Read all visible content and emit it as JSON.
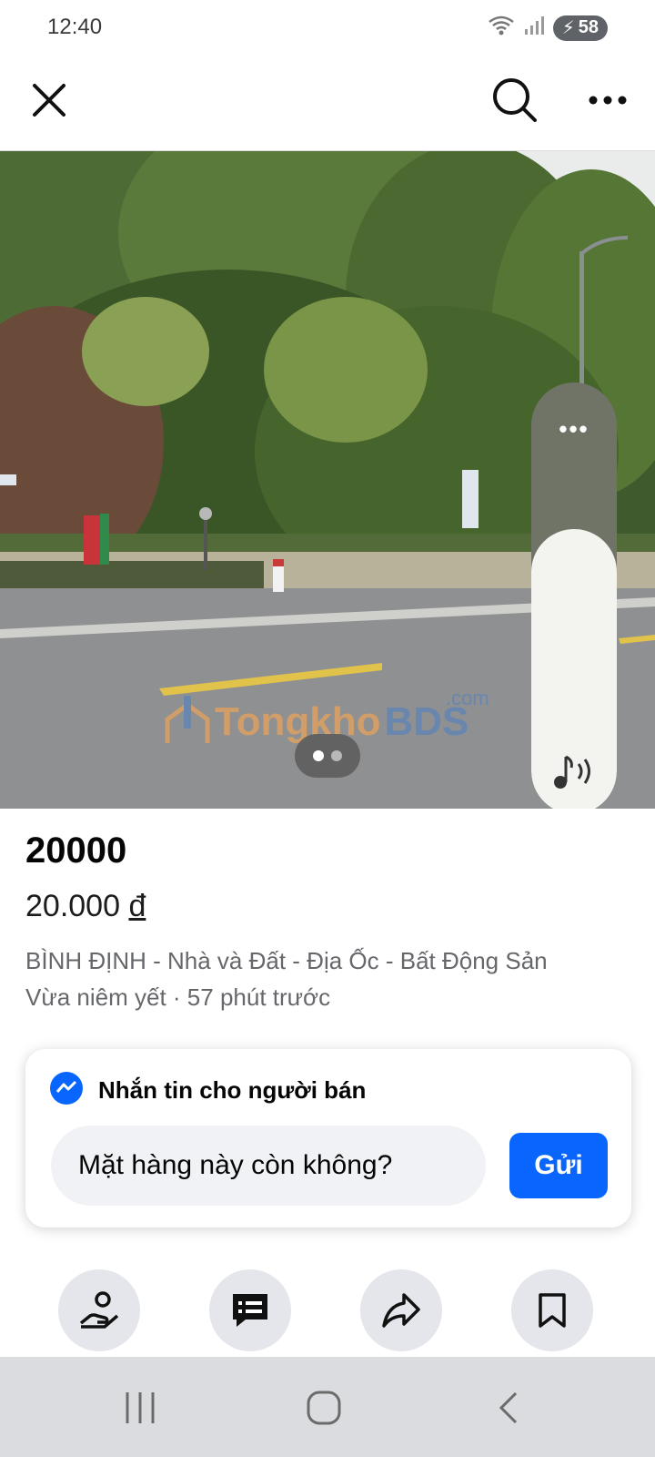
{
  "status_bar": {
    "time": "12:40",
    "battery": "58",
    "icons": [
      "wifi-icon",
      "signal-icon",
      "battery-charging-icon"
    ]
  },
  "top_bar": {
    "icons": [
      "close-icon",
      "search-icon",
      "more-icon"
    ]
  },
  "media": {
    "watermark": {
      "left": "Tongkho",
      "right": "BDS",
      "suffix": ".com"
    },
    "pager": {
      "total": 2,
      "current": 1
    },
    "volume_level": 0.66
  },
  "listing": {
    "title": "20000",
    "price_value": "20.000",
    "price_currency": "đ",
    "category": "BÌNH ĐỊNH - Nhà và Đất - Địa Ốc - Bất Động Sản",
    "posted": "Vừa niêm yết · 57 phút trước"
  },
  "message": {
    "title": "Nhắn tin cho người bán",
    "input_value": "Mặt hàng này còn không?",
    "send_label": "Gửi",
    "icon": "messenger-icon"
  },
  "actions": [
    {
      "name": "offer-button",
      "icon": "hand-offer-icon"
    },
    {
      "name": "message-button",
      "icon": "message-icon"
    },
    {
      "name": "share-button",
      "icon": "share-icon"
    },
    {
      "name": "save-button",
      "icon": "bookmark-icon"
    }
  ],
  "colors": {
    "accent": "#0866ff",
    "secondary_text": "#65676b",
    "button_bg": "#e4e6eb",
    "nav_bg": "#dbdcdf"
  }
}
